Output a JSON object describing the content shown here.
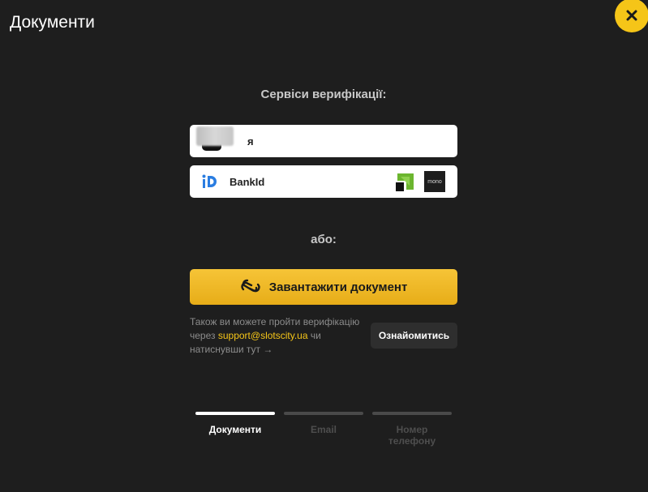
{
  "modal": {
    "title": "Документи",
    "close_icon": "close-icon"
  },
  "verification": {
    "title": "Сервіси верифікації:",
    "diia_label": "я",
    "bankid_label": "BankId",
    "bank_logos": [
      "privatbank-logo",
      "mono-logo"
    ],
    "mono_text": "mono"
  },
  "or_text": "або:",
  "upload_button": {
    "label": "Завантажити документ",
    "icon": "sumsub-icon"
  },
  "info": {
    "text_before": "Також ви можете пройти верифікацію через ",
    "email": "support@slotscity.ua",
    "text_after": " чи натиснувши тут →",
    "learn_button": "Ознайомитись"
  },
  "steps": [
    {
      "label": "Документи",
      "active": true
    },
    {
      "label": "Email",
      "active": false
    },
    {
      "label": "Номер телефону",
      "active": false
    }
  ],
  "colors": {
    "accent": "#f5c518",
    "background": "#1e1e1e"
  }
}
